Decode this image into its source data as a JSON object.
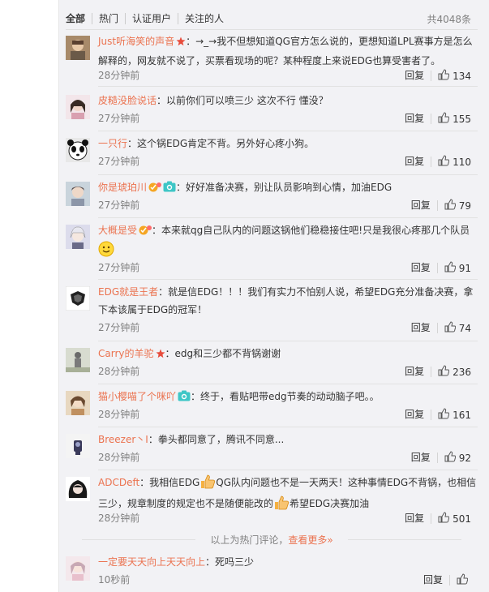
{
  "tabs": [
    "全部",
    "热门",
    "认证用户",
    "关注的人"
  ],
  "total": "共4048条",
  "reply_label": "回复",
  "comments": [
    {
      "user": "Just听海笑的声音",
      "text": "：→_→我不但想知道QG官方怎么说的，更想知道LPL赛事方是怎么解释的，网友就不说了，买票看现场的呢？某种程度上来说EDG也算受害者了。",
      "time": "28分钟前",
      "likes": "134"
    },
    {
      "user": "皮糙没脸说话",
      "text": "：以前你们可以喷三少 这次不行 懂没？",
      "time": "27分钟前",
      "likes": "155"
    },
    {
      "user": "一只行",
      "text": "：这个锅EDG肯定不背。另外好心疼小狗。",
      "time": "27分钟前",
      "likes": "110"
    },
    {
      "user": "你是琥珀川",
      "text": "：好好准备决赛，别让队员影响到心情，加油EDG",
      "time": "27分钟前",
      "likes": "79"
    },
    {
      "user": "大概是受",
      "text": "：本来就qg自己队内的问题这锅他们稳稳接住吧!只是我很心疼那几个队员",
      "time": "27分钟前",
      "likes": "91"
    },
    {
      "user": "EDG就是王者",
      "text": "：就是信EDG！！！我们有实力不怕别人说，希望EDG充分准备决赛，拿下本该属于EDG的冠军！",
      "time": "27分钟前",
      "likes": "74"
    },
    {
      "user": "Carry的羊驼",
      "text": "：edg和三少都不背锅谢谢",
      "time": "28分钟前",
      "likes": "236"
    },
    {
      "user": "猫小樱喵了个咪吖",
      "text": "：终于，看贴吧带edg节奏的动动脑子吧。。",
      "time": "28分钟前",
      "likes": "161"
    },
    {
      "user": "Breezer丶I",
      "text": "：拳头都同意了，腾讯不同意...",
      "time": "28分钟前",
      "likes": "92"
    },
    {
      "user": "ADCDeft",
      "text_a": "：我相信EDG",
      "text_b": "QG队内问题也不是一天两天！这种事情EDG不背锅，也相信三少，规章制度的规定也不是随便能改的",
      "text_c": "希望EDG决赛加油",
      "time": "28分钟前",
      "likes": "501"
    }
  ],
  "hot_note": "以上为热门评论，",
  "hot_more": "查看更多»",
  "latest": {
    "user": "一定要天天向上天天向上",
    "text": "：死吗三少",
    "time": "10秒前"
  },
  "colors": {
    "username": "#eb7350",
    "meta": "#808080"
  }
}
